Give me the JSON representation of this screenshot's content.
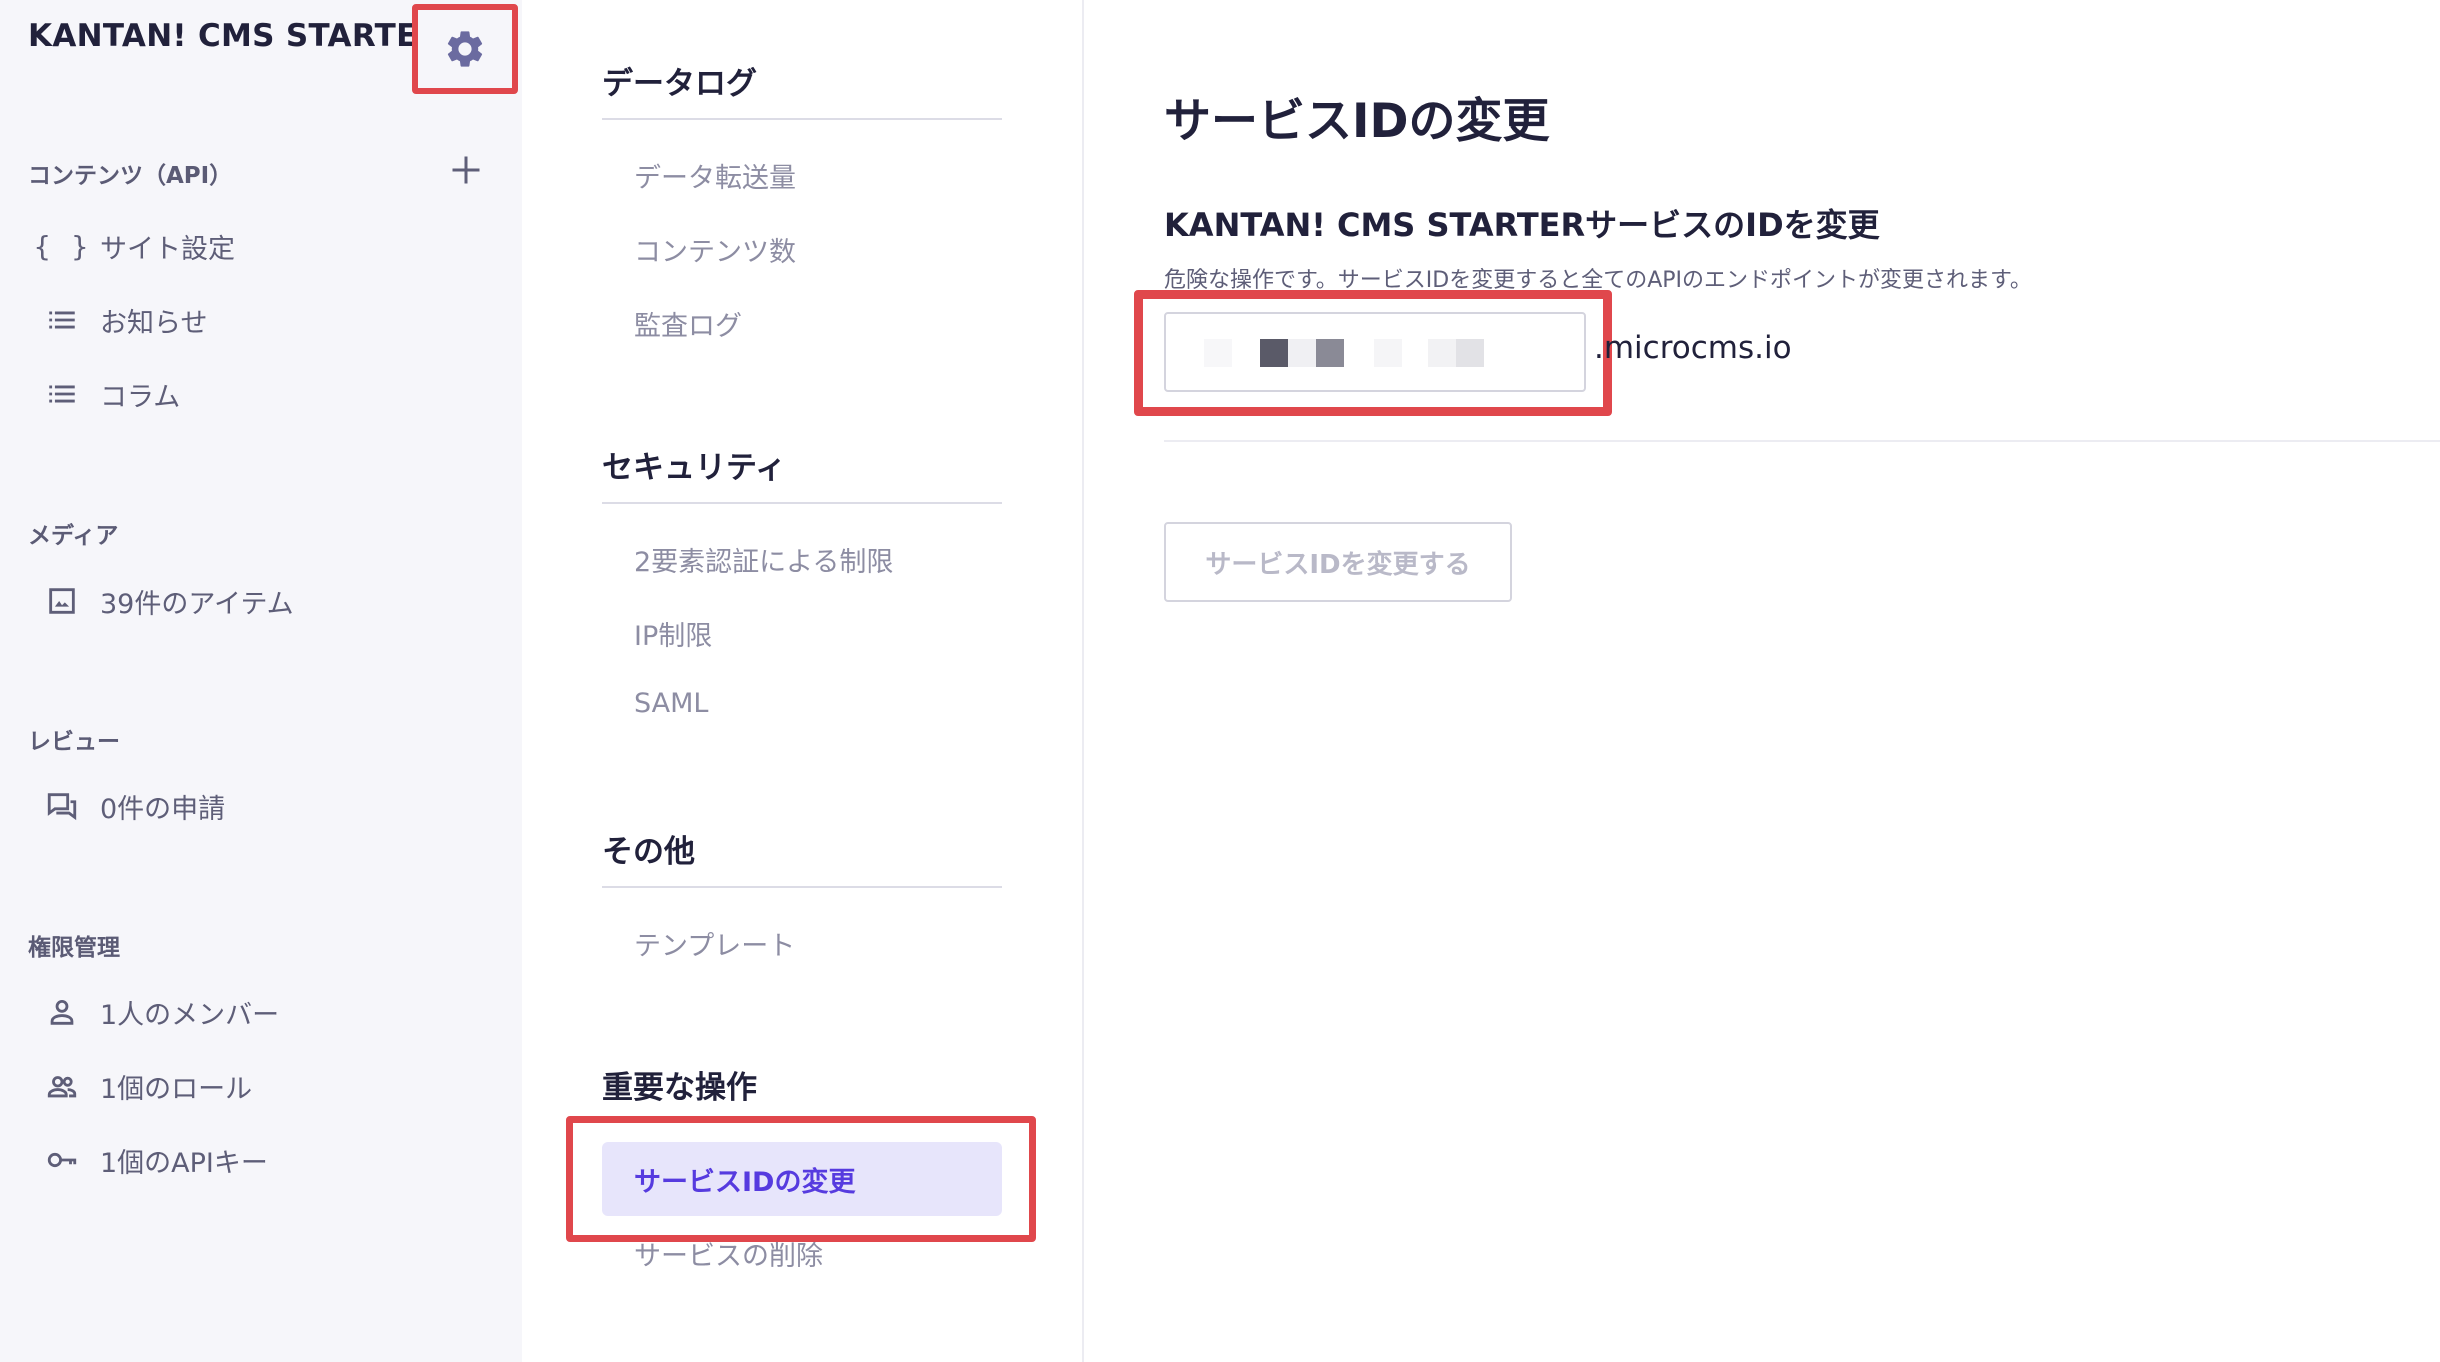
{
  "sidebar": {
    "app_title": "KANTAN! CMS STARTER",
    "sections": {
      "contents": {
        "label": "コンテンツ（API）",
        "items": [
          {
            "label": "サイト設定",
            "icon": "braces-icon"
          },
          {
            "label": "お知らせ",
            "icon": "list-icon"
          },
          {
            "label": "コラム",
            "icon": "list-icon"
          }
        ]
      },
      "media": {
        "label": "メディア",
        "items": [
          {
            "label": "39件のアイテム",
            "icon": "image-icon"
          }
        ]
      },
      "review": {
        "label": "レビュー",
        "items": [
          {
            "label": "0件の申請",
            "icon": "review-icon"
          }
        ]
      },
      "permissions": {
        "label": "権限管理",
        "items": [
          {
            "label": "1人のメンバー",
            "icon": "person-icon"
          },
          {
            "label": "1個のロール",
            "icon": "people-icon"
          },
          {
            "label": "1個のAPIキー",
            "icon": "key-icon"
          }
        ]
      }
    }
  },
  "settings_nav": {
    "data_log": {
      "heading": "データログ",
      "links": [
        "データ転送量",
        "コンテンツ数",
        "監査ログ"
      ]
    },
    "security": {
      "heading": "セキュリティ",
      "links": [
        "2要素認証による制限",
        "IP制限",
        "SAML"
      ]
    },
    "other": {
      "heading": "その他",
      "links": [
        "テンプレート"
      ]
    },
    "critical": {
      "heading": "重要な操作",
      "active": "サービスIDの変更",
      "links": [
        "サービスの削除"
      ]
    }
  },
  "main": {
    "title": "サービスIDの変更",
    "subtitle": "KANTAN! CMS STARTERサービスのIDを変更",
    "description": "危険な操作です。サービスIDを変更すると全てのAPIのエンドポイントが変更されます。",
    "domain_suffix": ".microcms.io",
    "submit_label": "サービスIDを変更する"
  },
  "colors": {
    "accent": "#563bdf",
    "active_bg": "#e7e5fb",
    "highlight_box": "#e0474c",
    "sidebar_bg": "#f6f6fa"
  }
}
